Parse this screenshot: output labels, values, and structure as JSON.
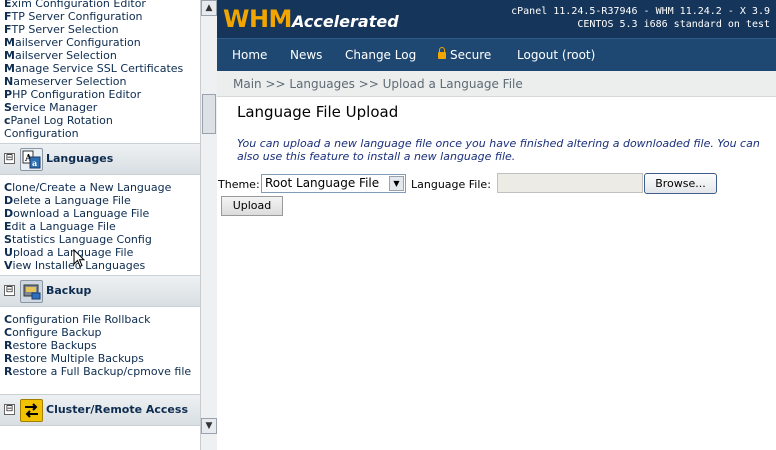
{
  "sidebar": {
    "top_links": [
      {
        "first": "E",
        "rest": "xim Configuration Editor"
      },
      {
        "first": "F",
        "rest": "TP Server Configuration"
      },
      {
        "first": "F",
        "rest": "TP Server Selection"
      },
      {
        "first": "M",
        "rest": "ailserver Configuration"
      },
      {
        "first": "M",
        "rest": "ailserver Selection"
      },
      {
        "first": "M",
        "rest": "anage Service SSL Certificates"
      },
      {
        "first": "N",
        "rest": "ameserver Selection"
      },
      {
        "first": "P",
        "rest": "HP Configuration Editor"
      },
      {
        "first": "S",
        "rest": "ervice Manager"
      },
      {
        "first": "c",
        "rest": "Panel Log Rotation"
      },
      {
        "first": "C",
        "rest": "onfiguration"
      }
    ],
    "languages_title": "Languages",
    "languages_links": [
      {
        "first": "C",
        "rest": "lone/Create a New Language"
      },
      {
        "first": "D",
        "rest": "elete a Language File"
      },
      {
        "first": "D",
        "rest": "ownload a Language File"
      },
      {
        "first": "E",
        "rest": "dit a Language File"
      },
      {
        "first": "S",
        "rest": "tatistics Language Config"
      },
      {
        "first": "U",
        "rest": "pload a Language File"
      },
      {
        "first": "V",
        "rest": "iew Installed Languages"
      }
    ],
    "backup_title": "Backup",
    "backup_links": [
      {
        "first": "C",
        "rest": "onfiguration File Rollback"
      },
      {
        "first": "C",
        "rest": "onfigure Backup"
      },
      {
        "first": "R",
        "rest": "estore Backups"
      },
      {
        "first": "R",
        "rest": "estore Multiple Backups"
      },
      {
        "first": "R",
        "rest": "estore a Full Backup/cpmove file"
      }
    ],
    "cluster_title": "Cluster/Remote Access",
    "toggle_symbol": "⊟"
  },
  "header": {
    "logo_main": "WHM",
    "logo_sub": "Accelerated",
    "version_line1": "cPanel 11.24.5-R37946 - WHM 11.24.2 - X 3.9",
    "version_line2": "CENTOS 5.3 i686 standard on test"
  },
  "nav": {
    "home": "Home",
    "news": "News",
    "changelog": "Change Log",
    "secure": "Secure",
    "logout": "Logout (root)"
  },
  "breadcrumb": "Main >> Languages >> Upload a Language File",
  "page": {
    "title": "Language File Upload",
    "description": "You can upload a new language file once you have finished altering a downloaded file. You can also use this feature to install a new language file."
  },
  "form": {
    "theme_label": "Theme:",
    "theme_value": "Root Language File",
    "file_label": "Language File:",
    "browse_label": "Browse...",
    "upload_label": "Upload"
  },
  "colors": {
    "header_bg": "#16355a",
    "nav_bg": "#1e4871",
    "logo_accent": "#f0a500",
    "link_color": "#0d2c4f",
    "description_color": "#1a2f7a"
  }
}
